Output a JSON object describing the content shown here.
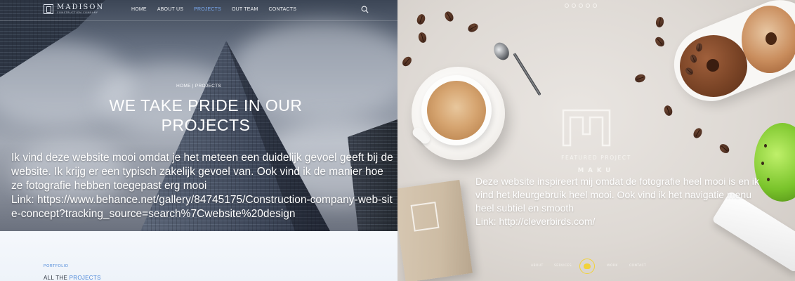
{
  "left": {
    "logo": {
      "name": "MADISON",
      "subtitle": "CONSTRUCTION COMPANY"
    },
    "nav": [
      {
        "label": "HOME",
        "active": false
      },
      {
        "label": "ABOUT US",
        "active": false
      },
      {
        "label": "PROJECTS",
        "active": true
      },
      {
        "label": "OUT TEAM",
        "active": false
      },
      {
        "label": "CONTACTS",
        "active": false
      }
    ],
    "search_icon": "search-icon",
    "breadcrumb": "HOME   |   PROJECTS",
    "hero_title": "WE TAKE PRIDE IN OUR PROJECTS",
    "note": "Ik vind deze website mooi omdat je het meteen een duidelijk gevoel geeft bij de website. Ik krijg er een typisch zakelijk gevoel van. Ook vind ik de manier hoe ze fotografie hebben toegepast erg mooi",
    "link": "Link: https://www.behance.net/gallery/84745175/Construction-company-web-site-concept?tracking_source=search%7Cwebsite%20design",
    "portfolio_label": "PORTFOLIO",
    "all_projects_prefix": "ALL THE ",
    "all_projects_highlight": "PROJECTS",
    "accent_color": "#4a86d8"
  },
  "right": {
    "featured_label": "FEATURED PROJECT",
    "project_name": "MAKU",
    "note": "Deze website inspireert mij omdat de fotografie heel mooi is en ik vind het kleurgebruik heel mooi. Ook vind ik het navigatie menu heel subtiel en smooth",
    "link": "Link: http://cleverbirds.com/",
    "bottom_nav": [
      "ABOUT",
      "SERVICES",
      "WORK",
      "CONTACT"
    ],
    "badge_color": "#f2d23a"
  }
}
